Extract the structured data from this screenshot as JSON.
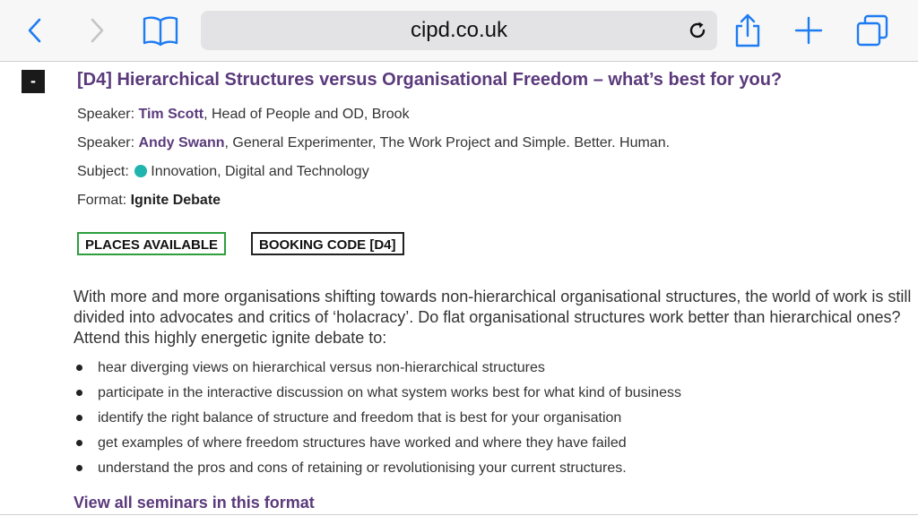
{
  "browser": {
    "url": "cipd.co.uk",
    "icons": {
      "back": "chevron-left-icon",
      "forward": "chevron-right-icon",
      "bookmarks": "open-book-icon",
      "reload": "reload-icon",
      "share": "share-icon",
      "new_tab": "plus-icon",
      "tabs": "tabs-icon"
    },
    "accent": "#1e7cf2"
  },
  "seminar": {
    "collapse_label": "-",
    "title": "[D4] Hierarchical Structures versus Organisational Freedom – what’s best for you?",
    "speakers": [
      {
        "label": "Speaker:",
        "name": "Tim Scott",
        "role": ", Head of People and OD, Brook"
      },
      {
        "label": "Speaker:",
        "name": "Andy Swann",
        "role": ", General Experimenter, The Work Project and Simple. Better. Human."
      }
    ],
    "subject": {
      "label": "Subject:",
      "value": "Innovation, Digital and Technology",
      "dot_color": "#1fb4ad"
    },
    "format": {
      "label": "Format:",
      "value": "Ignite Debate"
    },
    "badges": {
      "availability": "PLACES AVAILABLE",
      "booking_code": "BOOKING CODE [D4]"
    },
    "description": "With more and more organisations shifting towards non-hierarchical organisational structures, the world of work is still divided into advocates and critics of ‘holacracy’. Do flat organisational structures work better than hierarchical ones? Attend this highly energetic ignite debate to:",
    "bullets": [
      "hear diverging views on hierarchical versus non-hierarchical structures",
      "participate in the interactive discussion on what system works best for what kind of business",
      "identify the right balance of structure and freedom that is best for your organisation",
      "get examples of where freedom structures have worked and where they have failed",
      "understand the pros and cons of retaining or revolutionising your current structures."
    ],
    "view_all_link": "View all seminars in this format"
  },
  "colors": {
    "title_purple": "#5b3a7b",
    "available_green": "#2e9e3e"
  }
}
